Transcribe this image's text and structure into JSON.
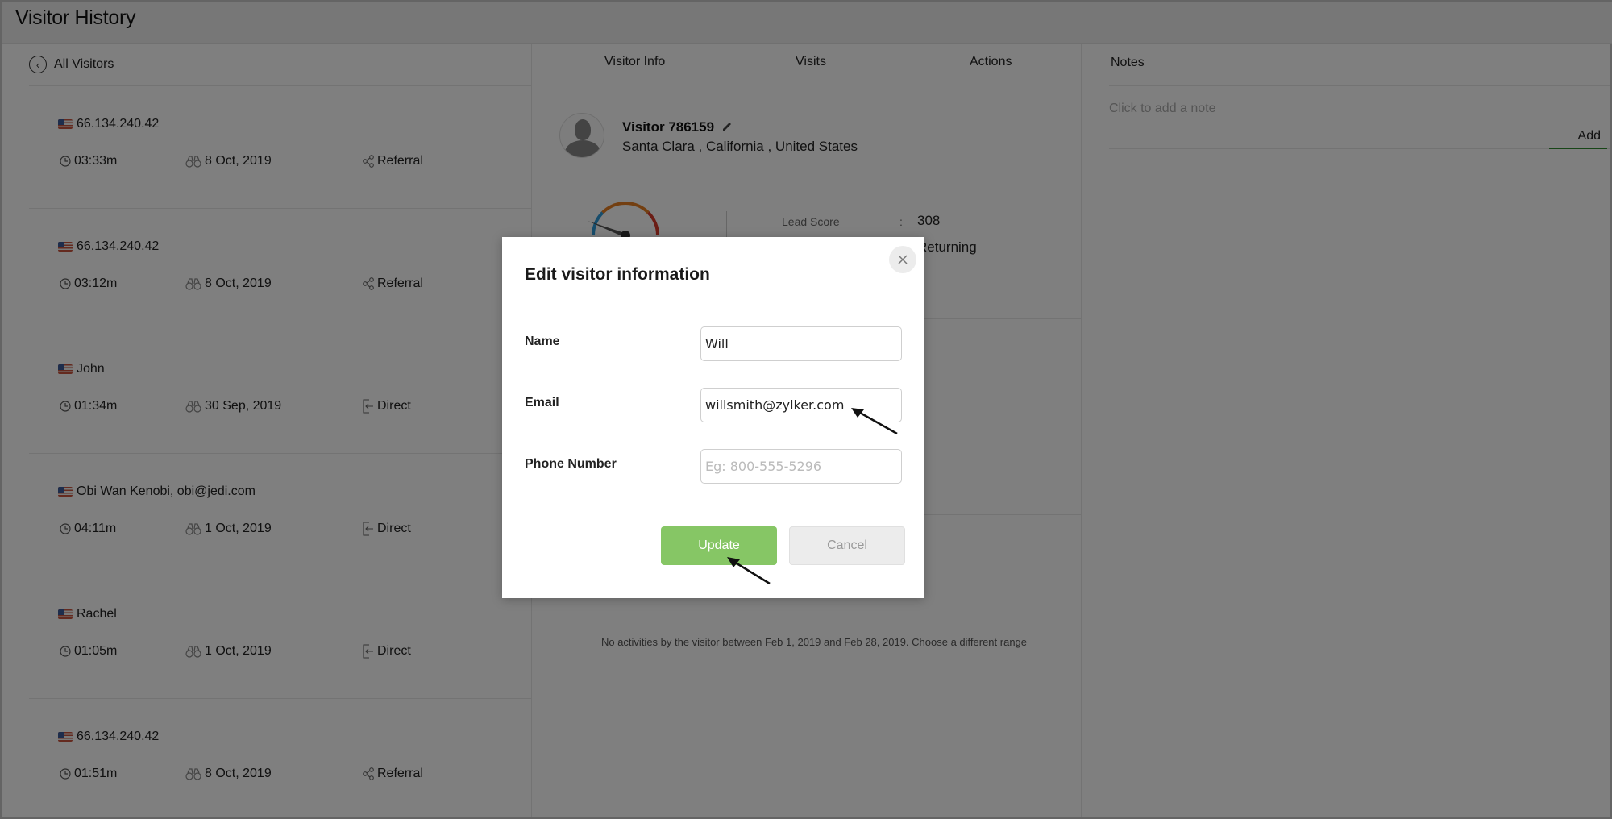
{
  "header": {
    "title": "Visitor History"
  },
  "left_panel": {
    "back_label": "All Visitors",
    "visits": [
      {
        "name": "66.134.240.42",
        "duration": "03:33m",
        "date": "8 Oct, 2019",
        "source": "Referral",
        "source_icon": "share-icon"
      },
      {
        "name": "66.134.240.42",
        "duration": "03:12m",
        "date": "8 Oct, 2019",
        "source": "Referral",
        "source_icon": "share-icon"
      },
      {
        "name": "John",
        "duration": "01:34m",
        "date": "30 Sep, 2019",
        "source": "Direct",
        "source_icon": "direct-entry-icon"
      },
      {
        "name": "Obi Wan Kenobi, obi@jedi.com",
        "duration": "04:11m",
        "date": "1 Oct, 2019",
        "source": "Direct",
        "source_icon": "direct-entry-icon"
      },
      {
        "name": "Rachel",
        "duration": "01:05m",
        "date": "1 Oct, 2019",
        "source": "Direct",
        "source_icon": "direct-entry-icon"
      },
      {
        "name": "66.134.240.42",
        "duration": "01:51m",
        "date": "8 Oct, 2019",
        "source": "Referral",
        "source_icon": "share-icon"
      }
    ]
  },
  "middle_panel": {
    "tabs": [
      {
        "label": "Visitor Info"
      },
      {
        "label": "Visits"
      },
      {
        "label": "Actions"
      }
    ],
    "visitor": {
      "title": "Visitor 786159",
      "location": "Santa Clara , California , United States"
    },
    "stats": {
      "lead_score_label": "Lead Score",
      "separator": ":",
      "lead_score_value": "308",
      "visitor_type_value": "Returning"
    },
    "gauge": {
      "colors": [
        "#2f9bd8",
        "#e67e22",
        "#d63a2a"
      ]
    },
    "empty_message": "No activities by the visitor between Feb 1, 2019 and Feb 28, 2019. Choose a different range"
  },
  "right_panel": {
    "title": "Notes",
    "note_placeholder": "Click to add a note",
    "add_label": "Add",
    "accent_color": "#2e8b2e"
  },
  "modal": {
    "title": "Edit visitor information",
    "fields": {
      "name": {
        "label": "Name",
        "value": "Will",
        "placeholder": ""
      },
      "email": {
        "label": "Email",
        "value": "willsmith@zylker.com",
        "placeholder": ""
      },
      "phone": {
        "label": "Phone Number",
        "value": "",
        "placeholder": "Eg: 800-555-5296"
      }
    },
    "update_label": "Update",
    "cancel_label": "Cancel",
    "update_color": "#86c665"
  }
}
